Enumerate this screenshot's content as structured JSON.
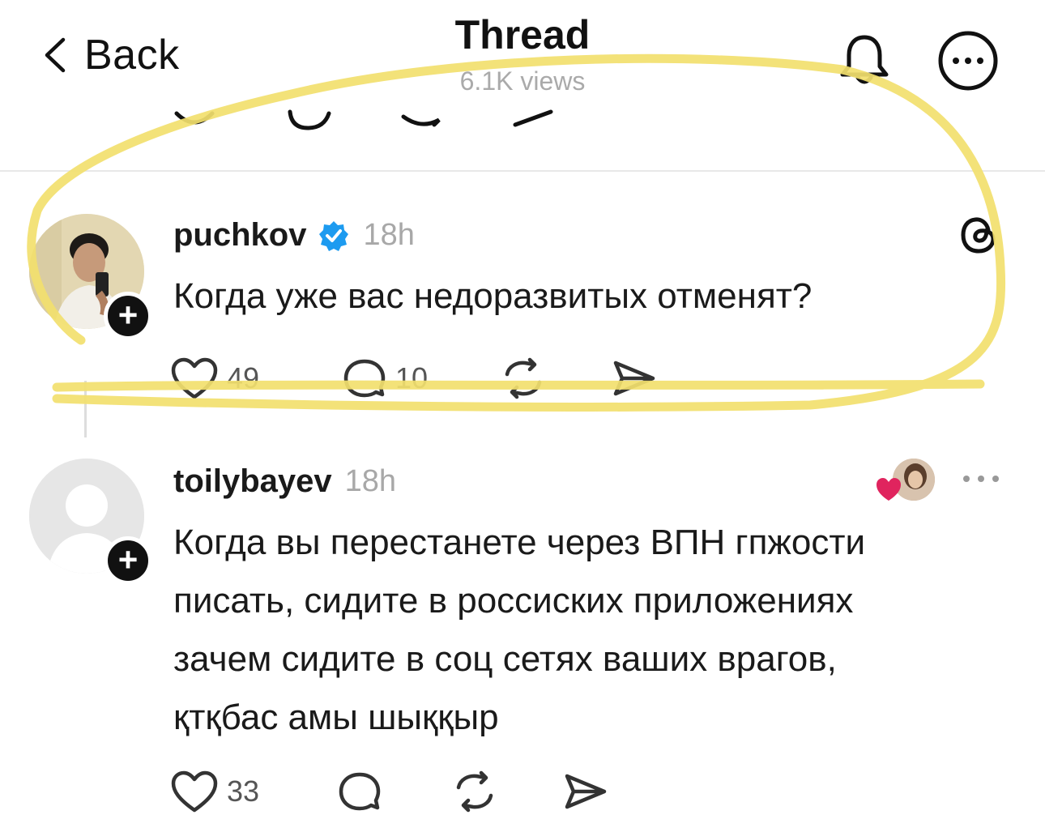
{
  "header": {
    "back_label": "Back",
    "title": "Thread",
    "views": "6.1K views"
  },
  "posts": [
    {
      "username": "puchkov",
      "verified": true,
      "time": "18h",
      "text": "Когда уже вас недоразвитых отменят?",
      "likes": "49",
      "replies": "10"
    },
    {
      "username": "toilybayev",
      "time": "18h",
      "text_lines": [
        "Когда вы перестанете через ВПН гпжости",
        "писать, сидите в россиских приложениях",
        "зачем сидите в соц сетях ваших врагов,",
        "қтқбас амы шыққыр"
      ],
      "likes": "33"
    }
  ],
  "colors": {
    "highlight": "#f2df6e",
    "verified": "#1d9bf0",
    "liked_heart": "#e0245e"
  },
  "icons": [
    "chevron-left-icon",
    "bell-icon",
    "more-circle-icon",
    "heart-icon",
    "comment-icon",
    "repost-icon",
    "share-icon",
    "threads-logo-icon",
    "verified-badge-icon",
    "plus-icon"
  ]
}
